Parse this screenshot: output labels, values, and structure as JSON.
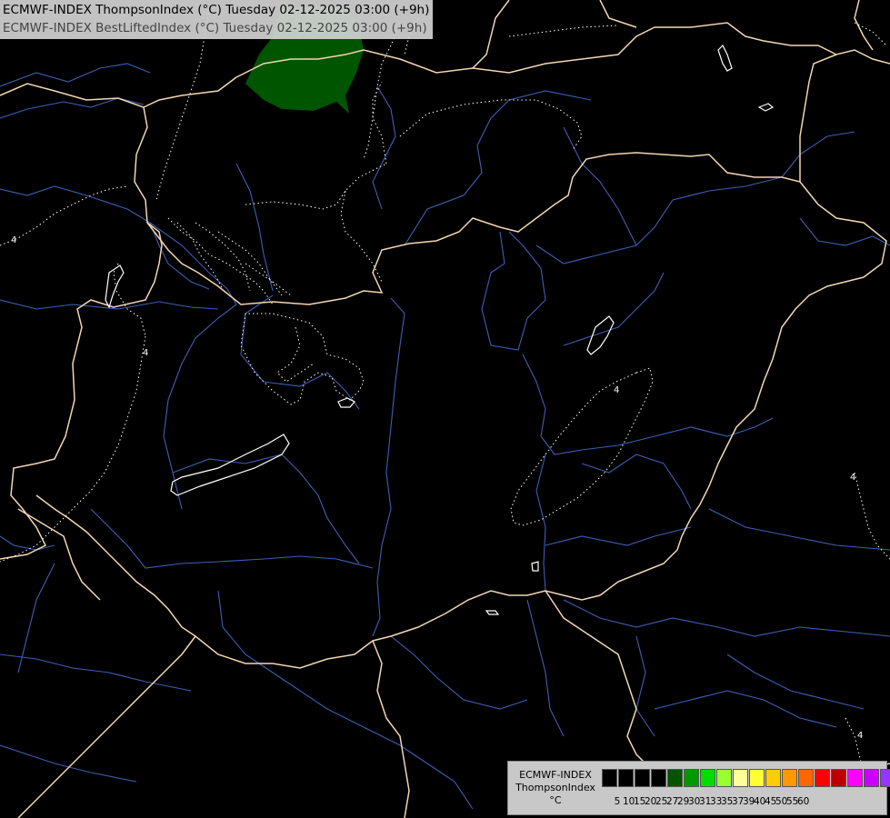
{
  "header": {
    "line1": "ECMWF-INDEX ThompsonIndex (°C) Tuesday 02-12-2025 03:00 (+9h)",
    "line2": "ECMWF-INDEX BestLiftedIndex (°C) Tuesday 02-12-2025 03:00 (+9h)"
  },
  "legend": {
    "title": [
      "ECMWF-INDEX",
      "ThompsonIndex",
      "°C"
    ],
    "colors": [
      "#000000",
      "#000000",
      "#000000",
      "#000000",
      "#005500",
      "#009900",
      "#00dd00",
      "#99ff33",
      "#ffff99",
      "#ffff33",
      "#ffcc00",
      "#ff9900",
      "#ff6600",
      "#ff0000",
      "#bb0000",
      "#ff00ff",
      "#cc00ff",
      "#9933ff",
      "#6600ff",
      "#0000ff"
    ],
    "labels": [
      "5",
      "10",
      "15",
      "20",
      "25",
      "27",
      "29",
      "30",
      "31",
      "33",
      "35",
      "37",
      "39",
      "40",
      "45",
      "50",
      "55",
      "60"
    ]
  },
  "map": {
    "contour_labels": [
      "4",
      "4",
      "4",
      "4",
      "4"
    ],
    "colors": {
      "background": "#000000",
      "border": "#f2d7b2",
      "river": "#3d5fb5",
      "contour": "#ffffff",
      "thompson_fill": "#005500"
    }
  }
}
